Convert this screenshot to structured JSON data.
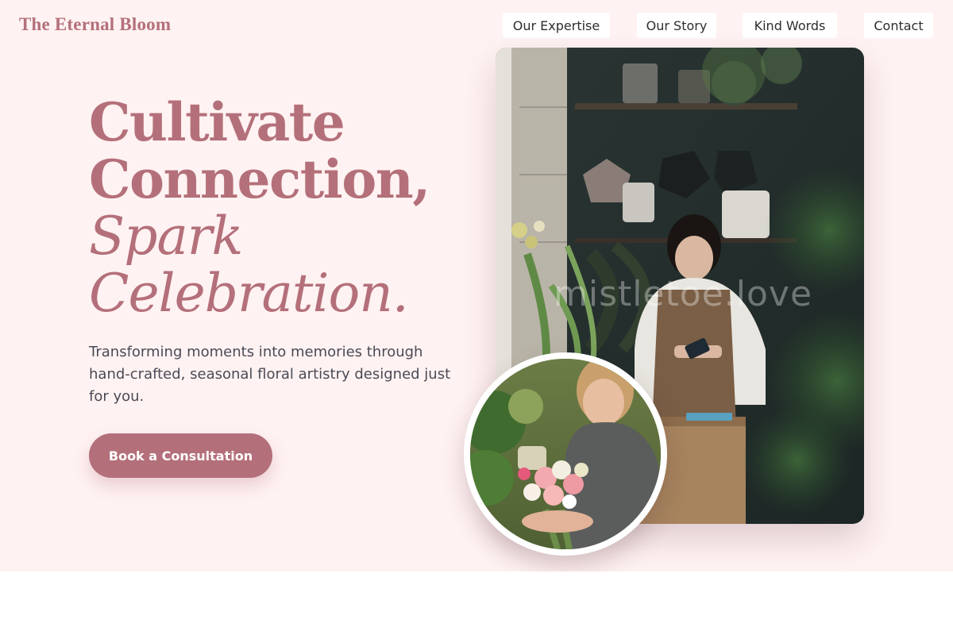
{
  "brand": {
    "name": "The Eternal Bloom"
  },
  "nav": {
    "items": [
      "Our Expertise",
      "Our Story",
      "Kind Words",
      "Contact"
    ]
  },
  "hero": {
    "headline_line1": "Cultivate",
    "headline_line2": "Connection,",
    "headline_line3": "Spark",
    "headline_line4": "Celebration.",
    "subtext": "Transforming moments into memories through hand-crafted, seasonal floral artistry designed just for you.",
    "cta_label": "Book a Consultation"
  },
  "images": {
    "main_photo": "florist-shop-photo",
    "main_watermark": "mistletoe.love",
    "circle_photo": "florist-bouquet-photo"
  },
  "colors": {
    "accent": "#b4707a",
    "hero_background": "#fff2f2",
    "body_text": "#4a4a55",
    "nav_text": "#2d2d2d"
  }
}
